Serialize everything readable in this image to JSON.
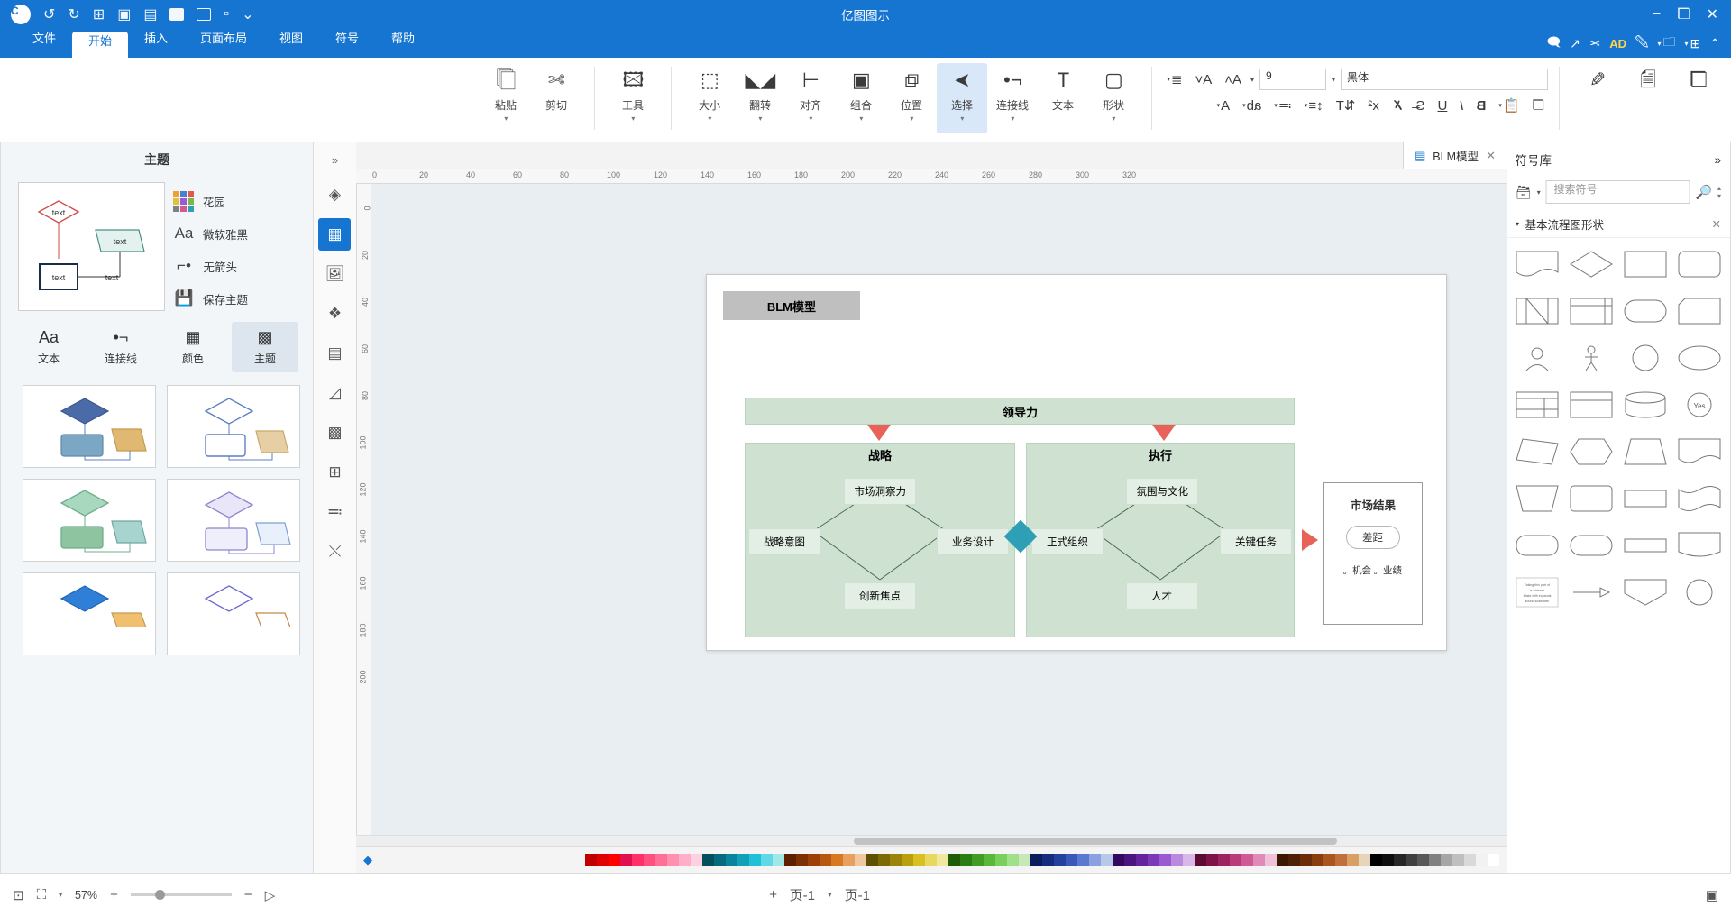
{
  "titlebar": {
    "title": "亿图图示",
    "left_icons": [
      "close-icon",
      "window-icon",
      "minimize-icon"
    ],
    "right_icons": [
      "chevron-down-icon",
      "minimize-icon",
      "restore-icon",
      "save-icon",
      "folder-icon",
      "add-icon",
      "undo-icon",
      "redo-icon"
    ],
    "avatar": "C"
  },
  "menubar": {
    "quick_access": [
      "back-icon",
      "grid-icon",
      "folder-icon",
      "paint-icon",
      "AD",
      "cut-icon",
      "cursor-icon",
      "comment-icon"
    ],
    "tabs": [
      {
        "label": "文件",
        "active": false
      },
      {
        "label": "开始",
        "active": true
      },
      {
        "label": "插入",
        "active": false
      },
      {
        "label": "页面布局",
        "active": false
      },
      {
        "label": "视图",
        "active": false
      },
      {
        "label": "符号",
        "active": false
      },
      {
        "label": "帮助",
        "active": false
      }
    ]
  },
  "ribbon": {
    "groups": [
      {
        "buttons": [
          {
            "label": "粘贴",
            "icon": "clipboard-icon",
            "dropdown": true,
            "selected": false
          },
          {
            "label": "剪切",
            "icon": "scissors-icon",
            "dropdown": false,
            "selected": false
          }
        ]
      }
    ],
    "tools": [
      {
        "label": "工具",
        "icon": "tools-icon",
        "dropdown": true,
        "selected": false
      },
      {
        "label": "大小",
        "icon": "size-icon",
        "dropdown": true,
        "selected": false
      },
      {
        "label": "翻转",
        "icon": "flip-icon",
        "dropdown": true,
        "selected": false
      },
      {
        "label": "对齐",
        "icon": "align-icon",
        "dropdown": true,
        "selected": false
      },
      {
        "label": "组合",
        "icon": "group-icon",
        "dropdown": true,
        "selected": false
      },
      {
        "label": "位置",
        "icon": "position-icon",
        "dropdown": true,
        "selected": false
      },
      {
        "label": "选择",
        "icon": "pointer-icon",
        "dropdown": true,
        "selected": true
      },
      {
        "label": "连接线",
        "icon": "connector-icon",
        "dropdown": true,
        "selected": false
      },
      {
        "label": "文本",
        "icon": "text-icon",
        "dropdown": false,
        "selected": false
      },
      {
        "label": "形状",
        "icon": "shape-icon",
        "dropdown": true,
        "selected": false
      }
    ],
    "font": {
      "family_value": "黑体",
      "size_value": "9",
      "row1_buttons": [
        "list-icon",
        "decrease-font-icon",
        "increase-font-icon"
      ],
      "row2_buttons": [
        "font-color-icon",
        "highlight-icon",
        "bullets-icon",
        "line-spacing-icon",
        "text-direction-icon",
        "strikethrough-icon",
        "clear-format-icon",
        "align-center-icon",
        "underline-icon",
        "italic-icon",
        "bold-icon"
      ]
    },
    "right_buttons": [
      "pen-icon",
      "copy-format-icon",
      "duplicate-icon"
    ]
  },
  "left_panel": {
    "title": "主题",
    "options": [
      {
        "label": "花园",
        "icon": "color-swatches-icon"
      },
      {
        "label": "微软雅黑",
        "icon": "font-icon"
      },
      {
        "label": "无箭头",
        "icon": "connector-style-icon"
      },
      {
        "label": "保存主题",
        "icon": "save-icon"
      }
    ],
    "tabs": [
      {
        "label": "文本",
        "icon": "font-icon",
        "active": false
      },
      {
        "label": "连接线",
        "icon": "connector-icon",
        "active": false
      },
      {
        "label": "颜色",
        "icon": "grid-color-icon",
        "active": false
      },
      {
        "label": "主题",
        "icon": "theme-icon",
        "active": true
      }
    ],
    "preview_labels": [
      "text",
      "text",
      "text",
      "text"
    ]
  },
  "rail": {
    "collapse_icon": "double-chevron-left-icon",
    "buttons": [
      {
        "icon": "fill-icon",
        "active": false
      },
      {
        "icon": "shapes-grid-icon",
        "active": true
      },
      {
        "icon": "image-icon",
        "active": false
      },
      {
        "icon": "layers-icon",
        "active": false
      },
      {
        "icon": "page-icon",
        "active": false
      },
      {
        "icon": "chart-icon",
        "active": false
      },
      {
        "icon": "table-icon",
        "active": false
      },
      {
        "icon": "template-icon",
        "active": false
      },
      {
        "icon": "list-icon",
        "active": false
      },
      {
        "icon": "shuffle-icon",
        "active": false
      }
    ]
  },
  "doctab": {
    "label": "BLM模型",
    "close": "×",
    "icon": "document-icon"
  },
  "rulers": {
    "h_ticks": [
      "0",
      "20",
      "40",
      "60",
      "80",
      "100",
      "120",
      "140",
      "160",
      "180",
      "200",
      "220",
      "240",
      "260",
      "280",
      "300",
      "320"
    ],
    "v_ticks": [
      "0",
      "20",
      "40",
      "60",
      "80",
      "100",
      "120",
      "140",
      "160",
      "180",
      "200"
    ]
  },
  "diagram": {
    "title": "BLM模型",
    "bands": [
      {
        "label": "领导力"
      },
      {
        "label": "执行"
      },
      {
        "label": "战略"
      }
    ],
    "execution_nodes": [
      "关键任务",
      "正式组织",
      "人才",
      "氛围与文化"
    ],
    "strategy_nodes": [
      "市场洞察力",
      "创新焦点",
      "业务设计",
      "战略意图"
    ],
    "result_box": {
      "title": "市场结果",
      "gap_label": "差距",
      "bullets": [
        "。业绩",
        "。机会"
      ]
    }
  },
  "right_panel": {
    "title": "符号库",
    "search_placeholder": "搜索符号",
    "search_icons": [
      "search-icon",
      "library-icon"
    ],
    "section_title": "基本流程图形状",
    "collapse_icon": "double-chevron-right-icon",
    "close_icon": "close-icon",
    "shapes": [
      "document",
      "diamond",
      "rectangle",
      "rounded-rect",
      "split-process",
      "internal-storage",
      "terminator",
      "card",
      "actor-head",
      "actor-person",
      "circle",
      "ellipse",
      "table-shape",
      "parallelogram-3d",
      "cylinder",
      "yes-no-badge",
      "tape",
      "hexagon",
      "trapezoid",
      "wave-doc",
      "trapezoid-2",
      "rounded-box",
      "rect-thin",
      "wave-shape",
      "rounded-rect-2",
      "stadium",
      "flat-rect",
      "flag-shape",
      "note-text",
      "arrow-left-box",
      "pentagon-down",
      "circle-2"
    ],
    "note_text": "Taking this part of nodes\nis address\nMake with expands\nsound scale with"
  },
  "statusbar": {
    "left_icons": [
      "fit-page-icon",
      "fullscreen-icon"
    ],
    "zoom_value": "57%",
    "zoom_minus": "−",
    "zoom_plus": "+",
    "play_icon": "presentation-icon",
    "page_label": "页-1",
    "page_add": "+",
    "page_selector": "页-1",
    "right_icon": "layout-icon"
  },
  "colors": {
    "accent": "#1675d1",
    "band": "#cfe2d2",
    "node": "#e3efe5",
    "diamond": "#2e9fb5",
    "arrow": "#e8625a",
    "title_bg": "#bfbfbf"
  },
  "palette_row": [
    "#ffffff",
    "#f2f2f2",
    "#d9d9d9",
    "#bfbfbf",
    "#a6a6a6",
    "#808080",
    "#595959",
    "#404040",
    "#262626",
    "#0d0d0d",
    "#000000",
    "#e8d4b8",
    "#d9a066",
    "#c0703a",
    "#a9561f",
    "#8a3e10",
    "#6b2d08",
    "#4f2104",
    "#3a1802",
    "#f0c0d8",
    "#e08ab8",
    "#cf5a96",
    "#b83a78",
    "#9c2360",
    "#7d1348",
    "#5e0a33",
    "#d8b8e8",
    "#b98ae0",
    "#9a5ad0",
    "#7c3ab8",
    "#62239c",
    "#4a137d",
    "#34085e",
    "#b8c8e8",
    "#8aa0e0",
    "#5a78d0",
    "#3a58b8",
    "#23409c",
    "#132c7d",
    "#081c5e",
    "#c8e8b8",
    "#a0e08a",
    "#78d05a",
    "#58b83a",
    "#409c23",
    "#2c7d13",
    "#1c5e08",
    "#f0e8a0",
    "#e8d860",
    "#d8c020",
    "#b8a010",
    "#9c8408",
    "#7d6a04",
    "#5e5002",
    "#f0c8a0",
    "#e8a060",
    "#d87820",
    "#b85810",
    "#9c4008",
    "#7d3004",
    "#5e2002",
    "#a0e8e8",
    "#60d8e8",
    "#20c0d8",
    "#10a0b8",
    "#08849c",
    "#046a7d",
    "#02505e",
    "#ffd0e0",
    "#ffb0c8",
    "#ff90b0",
    "#ff7098",
    "#ff5080",
    "#ff3068",
    "#e01050",
    "#ff0000",
    "#e00000",
    "#c00000"
  ]
}
